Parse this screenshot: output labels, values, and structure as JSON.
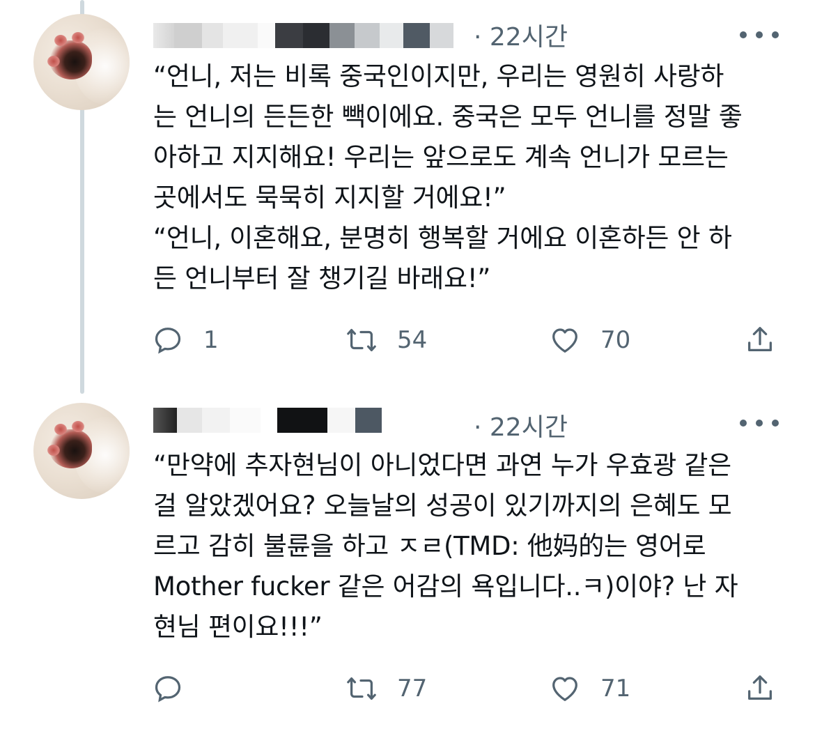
{
  "tweets": [
    {
      "time": "· 22시간",
      "text": "“언니, 저는 비록 중국인이지만, 우리는 영원히 사랑하\n는 언니의 든든한 빽이에요. 중국은 모두 언니를 정말 좋\n아하고 지지해요! 우리는 앞으로도 계속 언니가 모르는\n곳에서도 묵묵히 지지할 거에요!”\n“언니, 이혼해요, 분명히 행복할 거에요 이혼하든 안 하\n든 언니부터 잘 챙기길 바래요!”",
      "reply_count": "1",
      "retweet_count": "54",
      "like_count": "70"
    },
    {
      "time": "· 22시간",
      "text": "“만약에 추자현님이 아니었다면 과연 누가 우효광 같은\n걸 알았겠어요? 오늘날의 성공이 있기까지의 은혜도 모\n르고 감히 불륜을 하고 ㅈㄹ(TMD: 他妈的는 영어로\nMother fucker 같은 어감의 욕입니다..ㅋ)이야? 난 자\n현님 편이요!!!”",
      "reply_count": "",
      "retweet_count": "77",
      "like_count": "71"
    }
  ],
  "icons": {
    "reply": "reply-icon",
    "retweet": "retweet-icon",
    "like": "heart-icon",
    "share": "share-icon",
    "more": "more-icon"
  },
  "colors": {
    "text": "#0f1419",
    "secondary": "#536471",
    "thread_line": "#cfd9de"
  }
}
